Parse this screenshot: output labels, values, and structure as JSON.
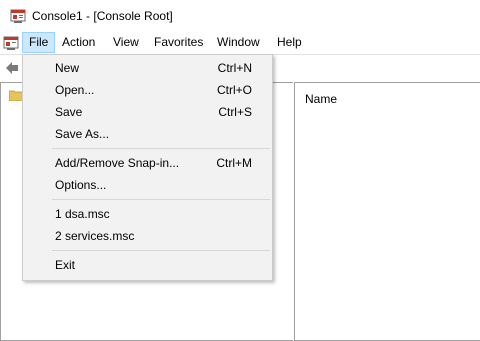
{
  "window": {
    "title": "Console1 - [Console Root]"
  },
  "menubar": {
    "items": [
      "File",
      "Action",
      "View",
      "Favorites",
      "Window",
      "Help"
    ],
    "active": "File"
  },
  "file_menu": {
    "items": [
      {
        "label": "New",
        "shortcut": "Ctrl+N"
      },
      {
        "label": "Open...",
        "shortcut": "Ctrl+O"
      },
      {
        "label": "Save",
        "shortcut": "Ctrl+S"
      },
      {
        "label": "Save As...",
        "shortcut": ""
      },
      {
        "label": "Add/Remove Snap-in...",
        "shortcut": "Ctrl+M"
      },
      {
        "label": "Options...",
        "shortcut": ""
      },
      {
        "label": "1 dsa.msc",
        "shortcut": ""
      },
      {
        "label": "2 services.msc",
        "shortcut": ""
      },
      {
        "label": "Exit",
        "shortcut": ""
      }
    ]
  },
  "result_pane": {
    "column_header": "Name"
  },
  "icons": {
    "app": "mmc-console-icon",
    "mdi": "console-window-icon",
    "back": "back-arrow-icon",
    "tree_root": "folder-icon"
  },
  "colors": {
    "menu_highlight": "#cce8ff",
    "menu_highlight_border": "#99d1ff",
    "folder": "#e8c25a"
  }
}
